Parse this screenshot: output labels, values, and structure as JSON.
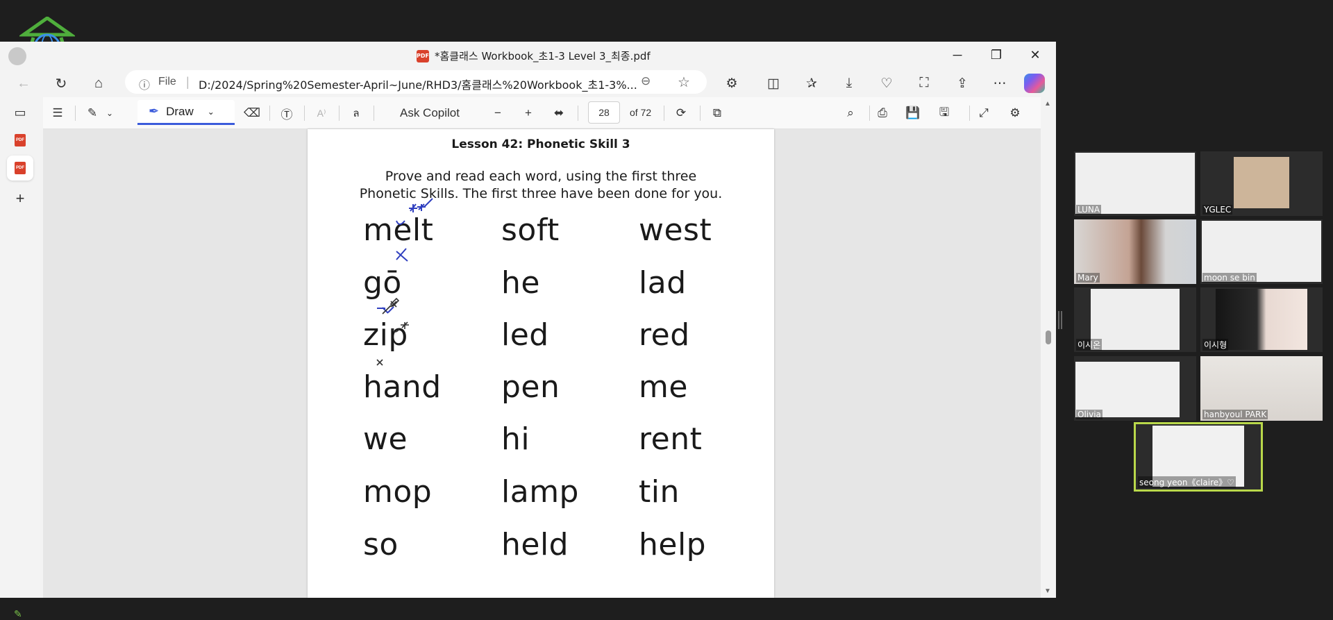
{
  "window": {
    "title": "*홈클래스 Workbook_초1-3 Level 3_최종.pdf",
    "controls": [
      "minimize-icon",
      "restore-icon",
      "close-icon"
    ]
  },
  "addressbar": {
    "info_icon": "ⓘ",
    "file_label": "File",
    "separator": "|",
    "url": "D:/2024/Spring%20Semester-April~June/RHD3/홈클래스%20Workbook_초1-3%..."
  },
  "pdf_toolbar": {
    "draw_label": "Draw",
    "ask_copilot_label": "Ask Copilot",
    "page_current": "28",
    "page_total": "of 72"
  },
  "document": {
    "lesson_title": "Lesson 42: Phonetic Skill 3",
    "instruction_line1": "Prove and read each word, using the first three",
    "instruction_line2": "Phonetic Skills. The first three have been done for you.",
    "words": [
      [
        "melt",
        "soft",
        "west"
      ],
      [
        "gō",
        "he",
        "lad"
      ],
      [
        "zip",
        "led",
        "red"
      ],
      [
        "hand",
        "pen",
        "me"
      ],
      [
        "we",
        "hi",
        "rent"
      ],
      [
        "mop",
        "lamp",
        "tin"
      ],
      [
        "so",
        "held",
        "help"
      ]
    ]
  },
  "participants": [
    {
      "name": "LUNA"
    },
    {
      "name": "YGLEC"
    },
    {
      "name": "Mary"
    },
    {
      "name": "moon se bin"
    },
    {
      "name": "이시온"
    },
    {
      "name": "이시형"
    },
    {
      "name": "Olivia"
    },
    {
      "name": "hanbyoul PARK"
    },
    {
      "name": "seong yeon《claire》♡"
    }
  ],
  "colors": {
    "accent": "#3b5bdb",
    "annotation": "#2f3fbf",
    "speaking_border": "#b9d84a",
    "pdf_red": "#d9412b"
  }
}
